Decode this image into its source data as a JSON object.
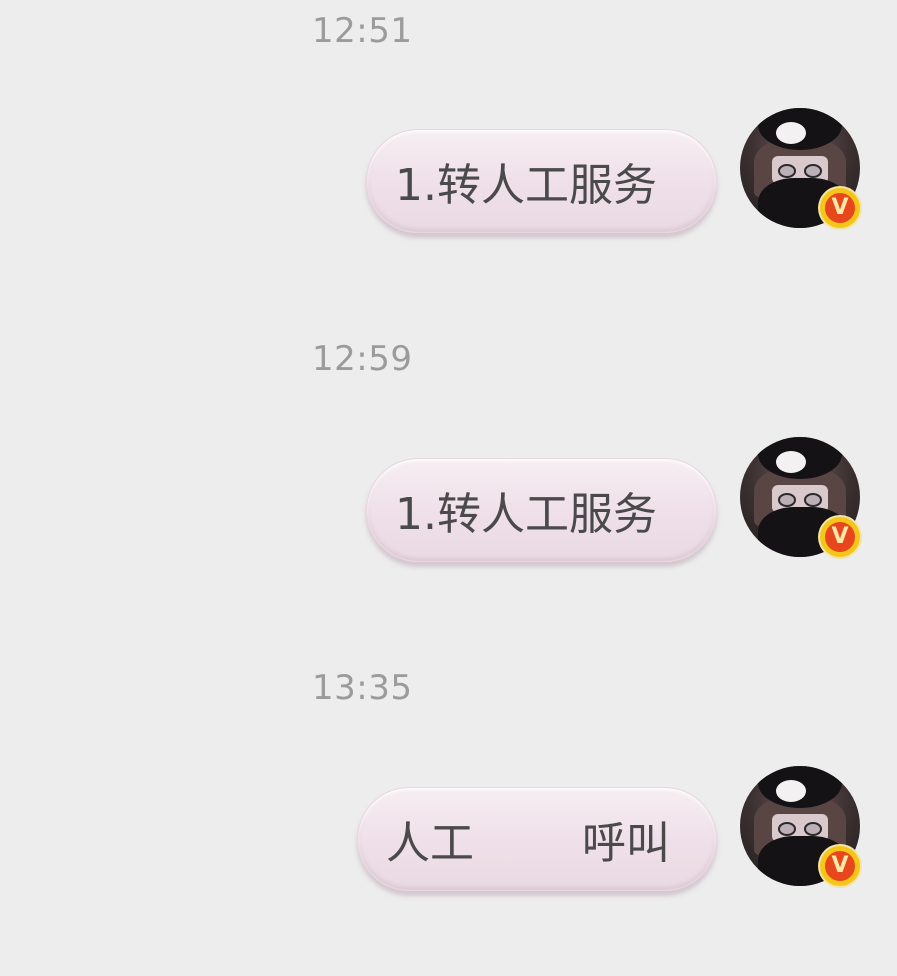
{
  "chat": {
    "messages": [
      {
        "time": "12:51",
        "text": "1.转人工服务",
        "badge": "V"
      },
      {
        "time": "12:59",
        "text": "1.转人工服务",
        "badge": "V"
      },
      {
        "time": "13:35",
        "text_left": "人工",
        "text_right": "呼叫",
        "badge": "V"
      }
    ]
  },
  "colors": {
    "background": "#ededed",
    "bubble": "#f2e6ec",
    "timestamp": "#9b9b9b",
    "text": "#4a4a4a",
    "badge_outer": "#f5c518",
    "badge_inner": "#e8461c"
  }
}
